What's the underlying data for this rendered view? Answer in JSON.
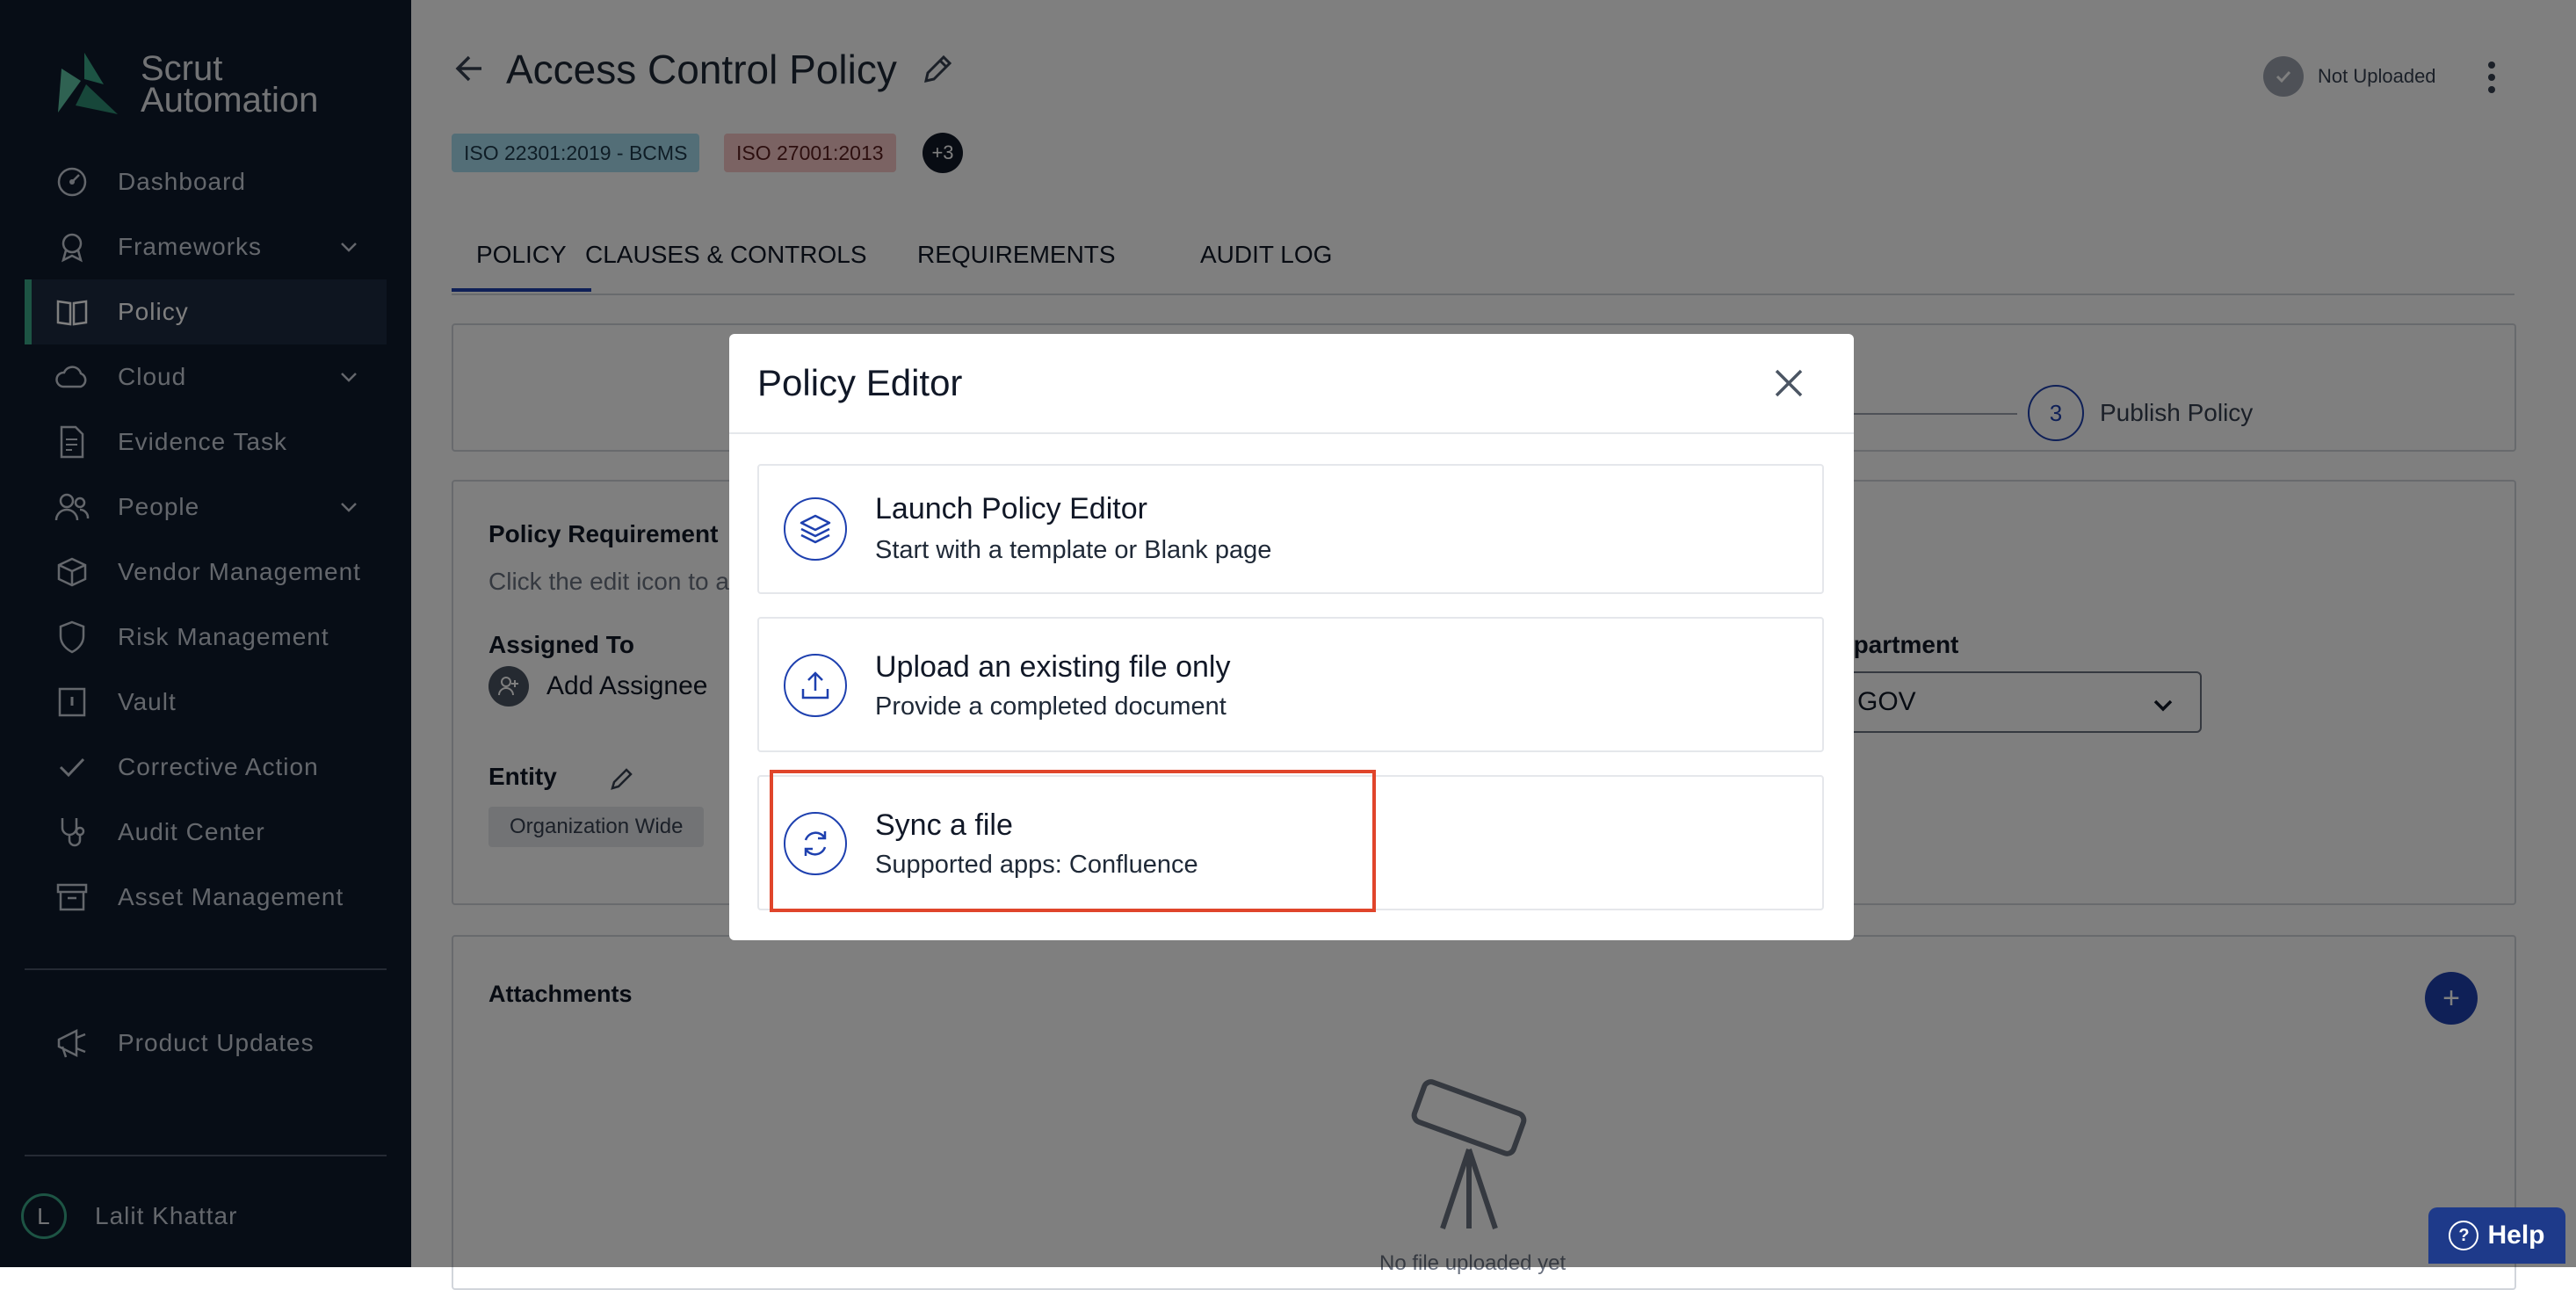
{
  "sidebar": {
    "brand": {
      "line1": "Scrut",
      "line2": "Automation"
    },
    "items": [
      {
        "label": "Dashboard",
        "icon": "dashboard-icon",
        "chevron": false
      },
      {
        "label": "Frameworks",
        "icon": "award-icon",
        "chevron": true
      },
      {
        "label": "Policy",
        "icon": "book-icon",
        "chevron": false,
        "active": true
      },
      {
        "label": "Cloud",
        "icon": "cloud-icon",
        "chevron": true
      },
      {
        "label": "Evidence Task",
        "icon": "document-icon",
        "chevron": false
      },
      {
        "label": "People",
        "icon": "people-icon",
        "chevron": true
      },
      {
        "label": "Vendor Management",
        "icon": "box-icon",
        "chevron": false
      },
      {
        "label": "Risk Management",
        "icon": "shield-icon",
        "chevron": false
      },
      {
        "label": "Vault",
        "icon": "vault-icon",
        "chevron": false
      },
      {
        "label": "Corrective Action",
        "icon": "check-icon",
        "chevron": false
      },
      {
        "label": "Audit Center",
        "icon": "stethoscope-icon",
        "chevron": false
      },
      {
        "label": "Asset Management",
        "icon": "archive-icon",
        "chevron": false
      }
    ],
    "product_updates": "Product Updates",
    "user": {
      "initial": "L",
      "name": "Lalit Khattar"
    }
  },
  "header": {
    "title": "Access Control Policy",
    "status": "Not Uploaded",
    "tags": [
      "ISO 22301:2019 - BCMS",
      "ISO 27001:2013"
    ],
    "more_tags": "+3"
  },
  "tabs": [
    "POLICY",
    "CLAUSES & CONTROLS",
    "REQUIREMENTS",
    "AUDIT LOG"
  ],
  "stepper": {
    "step_number": "3",
    "step_label": "Publish Policy"
  },
  "details": {
    "policy_requirement_label": "Policy Requirement",
    "policy_requirement_hint": "Click the edit icon to a",
    "assigned_to_label": "Assigned To",
    "add_assignee": "Add Assignee",
    "entity_label": "Entity",
    "entity_value": "Organization Wide",
    "department_label": "epartment",
    "department_value": "GOV"
  },
  "attachments": {
    "label": "Attachments",
    "plus": "+",
    "empty_text": "No file uploaded yet"
  },
  "help": {
    "label": "Help",
    "q": "?"
  },
  "modal": {
    "title": "Policy Editor",
    "options": [
      {
        "title": "Launch Policy Editor",
        "subtitle": "Start with a template or Blank page",
        "icon": "layers-icon"
      },
      {
        "title": "Upload an existing file only",
        "subtitle": "Provide a completed document",
        "icon": "upload-icon"
      },
      {
        "title": "Sync a file",
        "subtitle": "Supported apps: Confluence",
        "icon": "sync-icon"
      }
    ]
  },
  "colors": {
    "sidebar_bg": "#0f1b2d",
    "accent_green": "#3aa889",
    "primary_blue": "#1e40af",
    "highlight_red": "#e0452b"
  }
}
